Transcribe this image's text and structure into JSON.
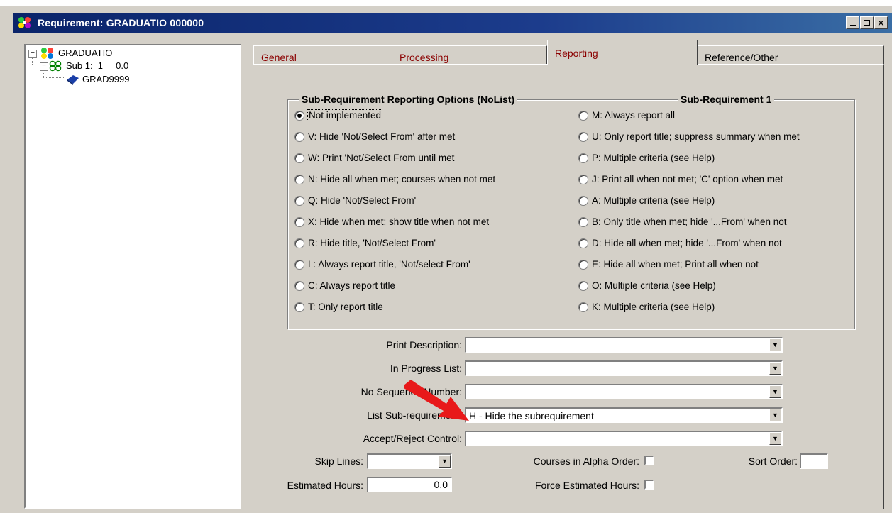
{
  "window": {
    "title": "Requirement: GRADUATIO 000000",
    "controls": [
      "minimize",
      "maximize",
      "close"
    ]
  },
  "tree": {
    "root": "GRADUATIO",
    "sub": "Sub 1:  1     0.0",
    "leaf": "GRAD9999"
  },
  "tabs": [
    {
      "label": "General",
      "active": false
    },
    {
      "label": "Processing",
      "active": false
    },
    {
      "label": "Reporting",
      "active": true
    },
    {
      "label": "Reference/Other",
      "active": false
    }
  ],
  "group": {
    "title": "Sub-Requirement Reporting Options (NoList)",
    "subtitle": "Sub-Requirement 1"
  },
  "options_left": [
    {
      "label": "Not implemented",
      "selected": true
    },
    {
      "label": "V: Hide 'Not/Select From' after met",
      "selected": false
    },
    {
      "label": "W: Print 'Not/Select From until met",
      "selected": false
    },
    {
      "label": "N: Hide all when met; courses when not met",
      "selected": false
    },
    {
      "label": "Q: Hide 'Not/Select From'",
      "selected": false
    },
    {
      "label": "X: Hide when met; show title when not met",
      "selected": false
    },
    {
      "label": "R: Hide title, 'Not/Select From'",
      "selected": false
    },
    {
      "label": "L: Always report title, 'Not/select From'",
      "selected": false
    },
    {
      "label": "C: Always report title",
      "selected": false
    },
    {
      "label": "T: Only report title",
      "selected": false
    }
  ],
  "options_right": [
    {
      "label": "M: Always report all",
      "selected": false
    },
    {
      "label": "U: Only report title; suppress summary when met",
      "selected": false
    },
    {
      "label": "P: Multiple criteria (see Help)",
      "selected": false
    },
    {
      "label": "J: Print all when not met; 'C' option when met",
      "selected": false
    },
    {
      "label": "A: Multiple criteria (see Help)",
      "selected": false
    },
    {
      "label": "B: Only title when met; hide '...From' when not",
      "selected": false
    },
    {
      "label": "D: Hide all when met; hide '...From' when not",
      "selected": false
    },
    {
      "label": "E: Hide all when met; Print all when not",
      "selected": false
    },
    {
      "label": "O: Multiple criteria (see Help)",
      "selected": false
    },
    {
      "label": "K: Multiple criteria (see Help)",
      "selected": false
    }
  ],
  "fields": {
    "print_description": {
      "label": "Print Description:",
      "value": ""
    },
    "in_progress_list": {
      "label": "In Progress List:",
      "value": ""
    },
    "no_sequence_number": {
      "label": "No Sequence Number:",
      "value": ""
    },
    "list_subrequirement": {
      "label": "List Sub-requirement:",
      "value": "H - Hide the subrequirement"
    },
    "accept_reject_control": {
      "label": "Accept/Reject Control:",
      "value": ""
    },
    "skip_lines": {
      "label": "Skip Lines:",
      "value": ""
    },
    "estimated_hours": {
      "label": "Estimated Hours:",
      "value": "0.0"
    },
    "courses_alpha_order": {
      "label": "Courses in Alpha Order:",
      "checked": false
    },
    "force_estimated_hours": {
      "label": "Force Estimated Hours:",
      "checked": false
    },
    "sort_order": {
      "label": "Sort Order:",
      "value": ""
    }
  },
  "colors": {
    "titlebar": "#0a246a",
    "dialog_face": "#d4d0c8",
    "tab_text_red": "#8b0000",
    "annotation_arrow": "#e8191a"
  }
}
